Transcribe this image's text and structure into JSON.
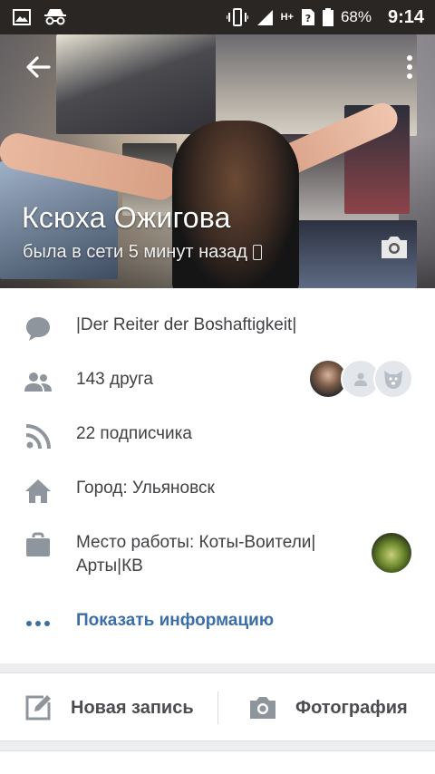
{
  "status_bar": {
    "battery_percent": "68%",
    "time": "9:14",
    "network_label": "H+"
  },
  "profile": {
    "name": "Ксюха Ожигова",
    "last_seen": "была в сети 5 минут назад"
  },
  "info": {
    "status_text": "|Der Reiter der Boshaftigkeit|",
    "friends": "143 друга",
    "followers": "22 подписчика",
    "city": "Город: Ульяновск",
    "work_line1": "Место работы: Коты-Воители|",
    "work_line2": "Арты|КВ",
    "show_info": "Показать информацию"
  },
  "actions": {
    "new_post": "Новая запись",
    "photo": "Фотография"
  },
  "colors": {
    "link": "#3b6ea6",
    "icon_gray": "#8f959c",
    "text": "#3f4144"
  },
  "icons": {
    "status": "speech-bubble-icon",
    "friends": "people-icon",
    "followers": "rss-icon",
    "city": "home-icon",
    "work": "briefcase-icon",
    "show_info": "ellipsis-icon",
    "new_post": "edit-icon",
    "photo": "camera-icon"
  }
}
